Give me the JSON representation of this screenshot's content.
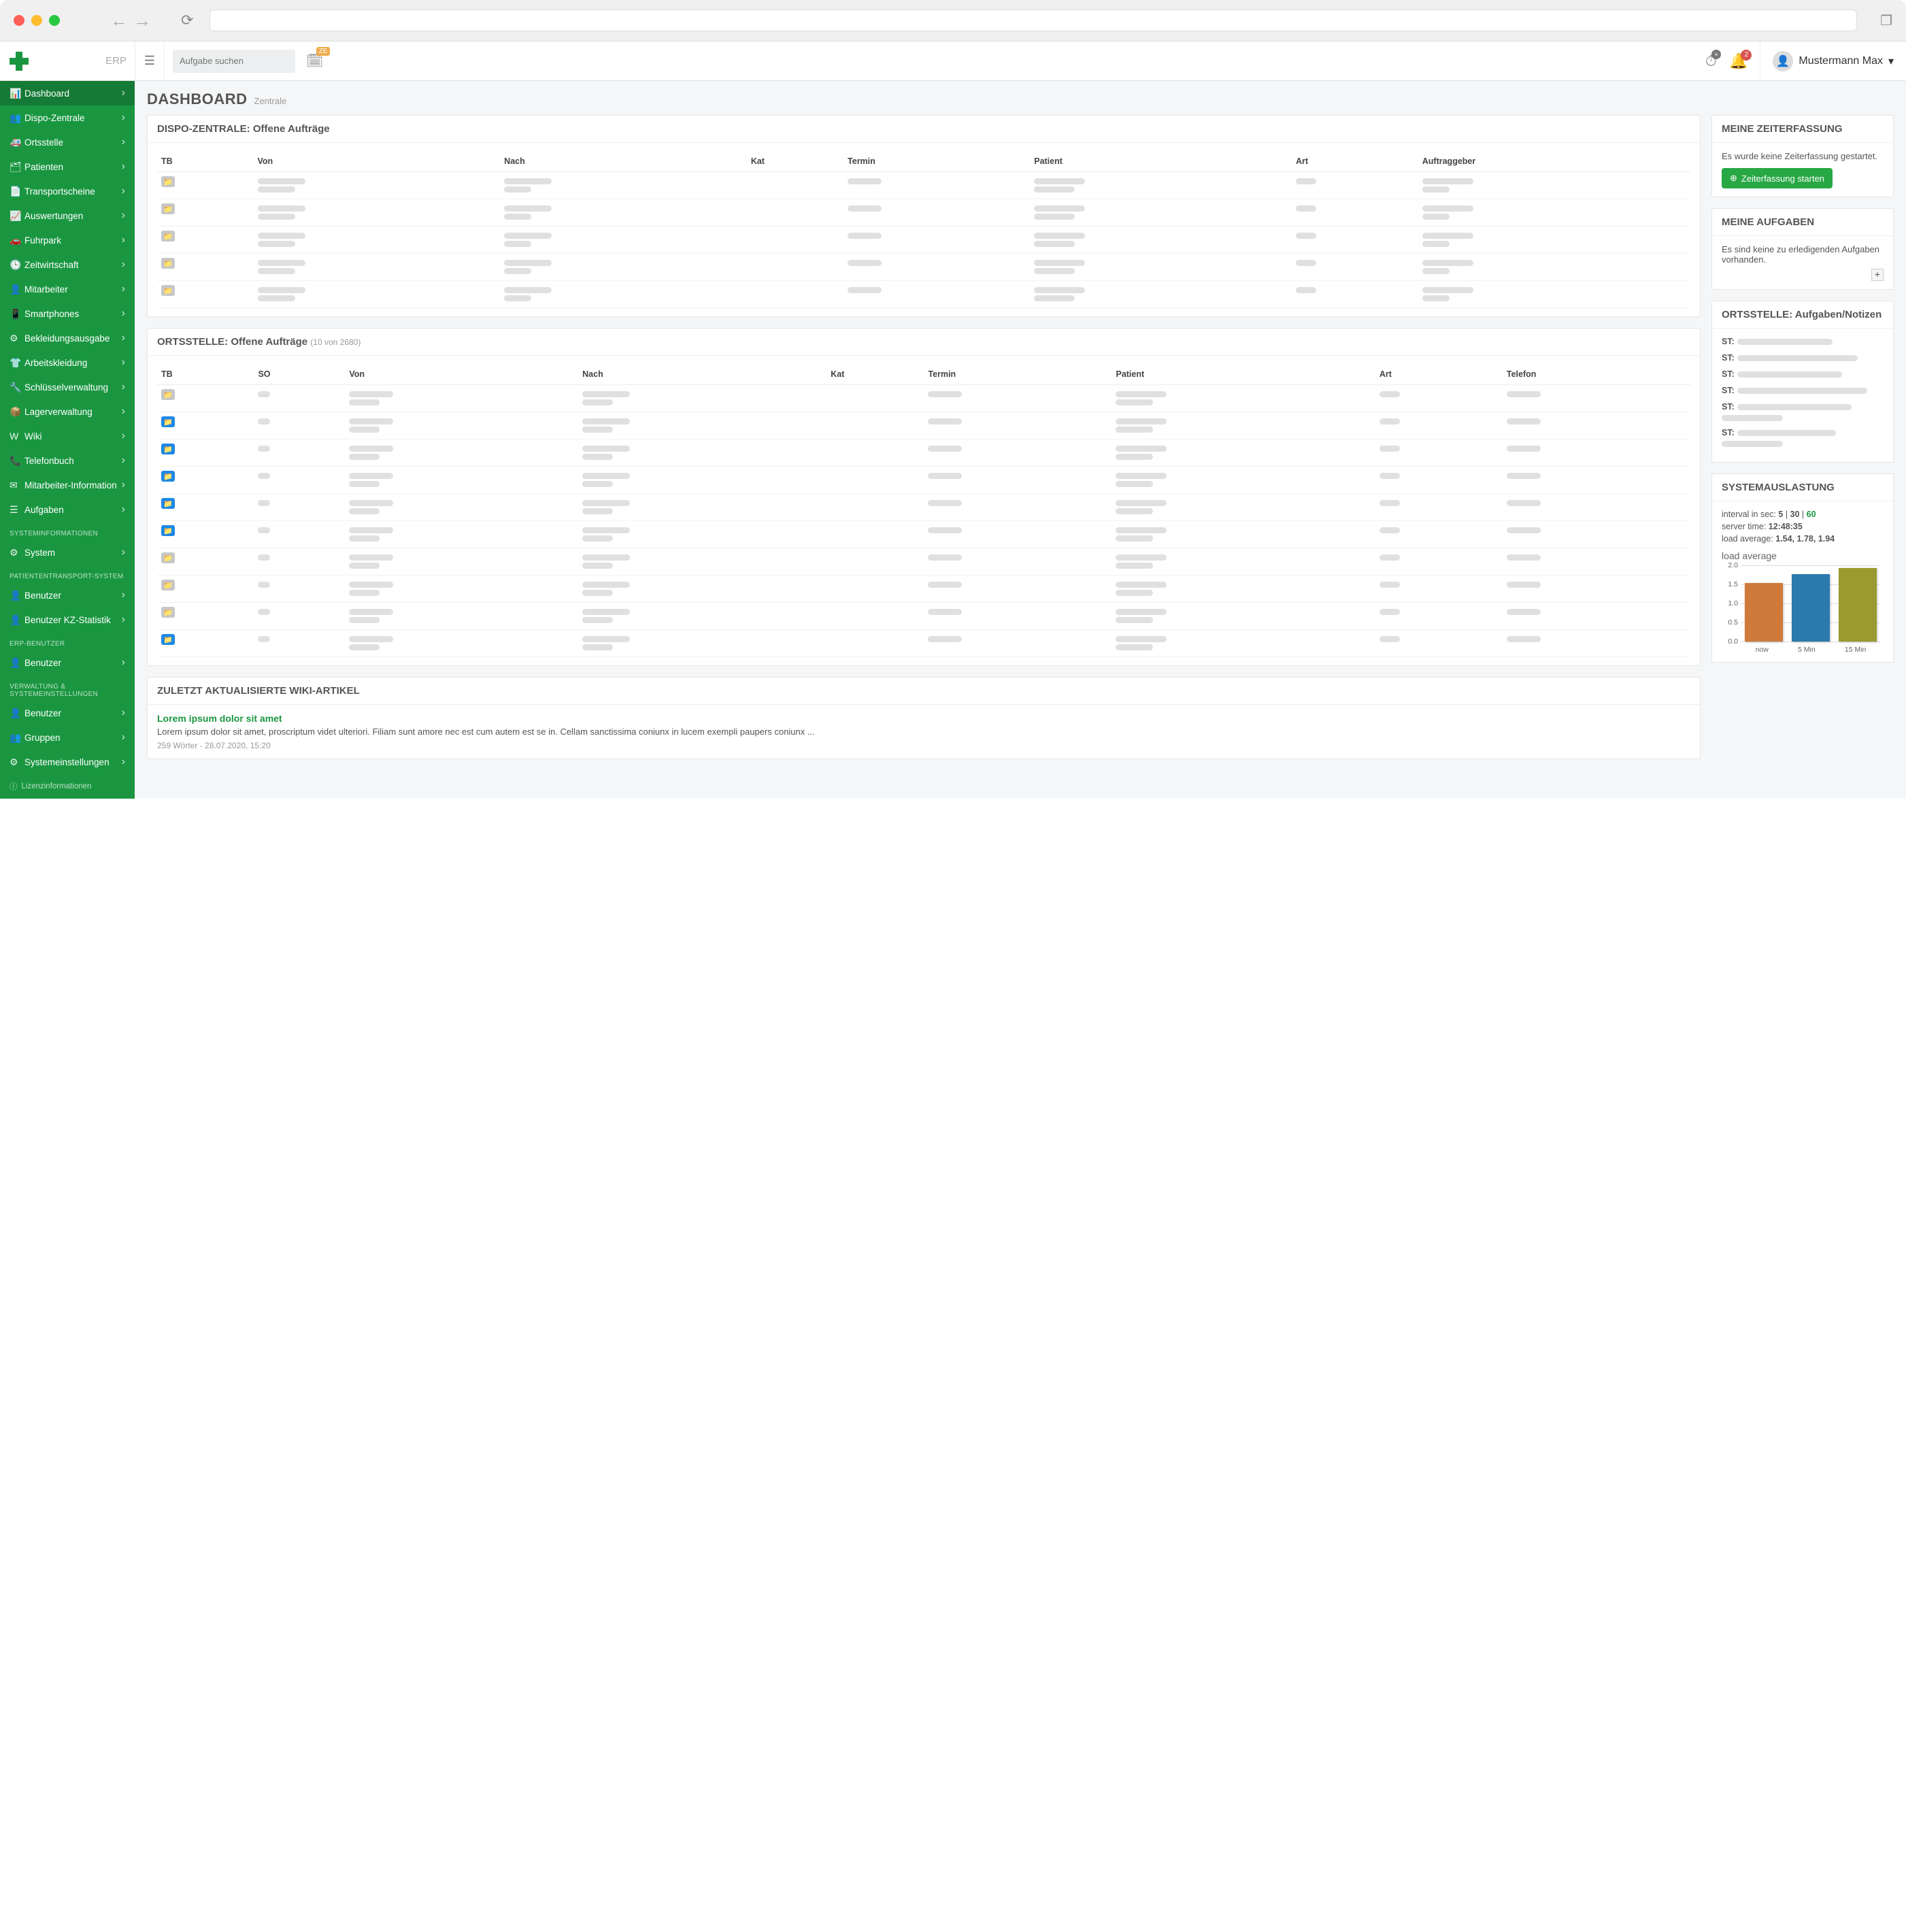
{
  "brand": {
    "text": "ERP"
  },
  "header": {
    "search_placeholder": "Aufgabe suchen",
    "ze_badge": "ZE",
    "notif_count": "2",
    "clock_badge": "×",
    "user_name": "Mustermann Max"
  },
  "sidebar": {
    "items": [
      {
        "icon": "📊",
        "label": "Dashboard",
        "active": true
      },
      {
        "icon": "👥",
        "label": "Dispo-Zentrale"
      },
      {
        "icon": "🚑",
        "label": "Ortsstelle"
      },
      {
        "icon": "🗂",
        "label": "Patienten"
      },
      {
        "icon": "📄",
        "label": "Transportscheine"
      },
      {
        "icon": "📈",
        "label": "Auswertungen"
      },
      {
        "icon": "🚗",
        "label": "Fuhrpark"
      },
      {
        "icon": "🕒",
        "label": "Zeitwirtschaft"
      },
      {
        "icon": "👤",
        "label": "Mitarbeiter"
      },
      {
        "icon": "📱",
        "label": "Smartphones"
      },
      {
        "icon": "⚙",
        "label": "Bekleidungsausgabe"
      },
      {
        "icon": "👕",
        "label": "Arbeitskleidung"
      },
      {
        "icon": "🔧",
        "label": "Schlüsselverwaltung"
      },
      {
        "icon": "📦",
        "label": "Lagerverwaltung"
      },
      {
        "icon": "W",
        "label": "Wiki"
      },
      {
        "icon": "📞",
        "label": "Telefonbuch"
      },
      {
        "icon": "✉",
        "label": "Mitarbeiter-Information"
      },
      {
        "icon": "☰",
        "label": "Aufgaben"
      }
    ],
    "sections": [
      {
        "title": "SYSTEMINFORMATIONEN",
        "items": [
          {
            "icon": "⚙",
            "label": "System"
          }
        ]
      },
      {
        "title": "PATIENTENTRANSPORT-SYSTEM",
        "items": [
          {
            "icon": "👤",
            "label": "Benutzer"
          },
          {
            "icon": "👤",
            "label": "Benutzer KZ-Statistik"
          }
        ]
      },
      {
        "title": "ERP-BENUTZER",
        "items": [
          {
            "icon": "👤",
            "label": "Benutzer"
          }
        ]
      },
      {
        "title": "VERWALTUNG & SYSTEMEINSTELLUNGEN",
        "items": [
          {
            "icon": "👤",
            "label": "Benutzer"
          },
          {
            "icon": "👥",
            "label": "Gruppen"
          },
          {
            "icon": "⚙",
            "label": "Systemeinstellungen"
          }
        ]
      }
    ],
    "footer": "Lizenzinformationen"
  },
  "page": {
    "title": "DASHBOARD",
    "subtitle": "Zentrale"
  },
  "panels": {
    "dispo": {
      "title": "DISPO-ZENTRALE: Offene Aufträge",
      "columns": [
        "TB",
        "Von",
        "Nach",
        "Kat",
        "Termin",
        "Patient",
        "Art",
        "Auftraggeber"
      ],
      "rows": 5
    },
    "ortsstelle": {
      "title": "ORTSSTELLE: Offene Aufträge",
      "title_suffix": "(10 von 2680)",
      "columns": [
        "TB",
        "SO",
        "Von",
        "Nach",
        "Kat",
        "Termin",
        "Patient",
        "Art",
        "Telefon"
      ],
      "row_styles": [
        "grey",
        "blue",
        "blue",
        "blue",
        "blue",
        "blue",
        "grey",
        "grey",
        "grey",
        "blue"
      ]
    },
    "wiki": {
      "title": "ZULETZT AKTUALISIERTE WIKI-ARTIKEL",
      "article_title": "Lorem ipsum dolor sit amet",
      "article_body": "Lorem ipsum dolor sit amet, proscriptum videt ulteriori. Filiam sunt amore nec est cum autem est se in. Cellam sanctissima coniunx in lucem exempli paupers coniunx ...",
      "article_meta": "259 Wörter - 28.07.2020, 15:20"
    },
    "zeiterfassung": {
      "title": "MEINE ZEITERFASSUNG",
      "text": "Es wurde keine Zeiterfassung gestartet.",
      "button": "Zeiterfassung starten"
    },
    "aufgaben": {
      "title": "MEINE AUFGABEN",
      "text": "Es sind keine zu erledigenden Aufgaben vorhanden."
    },
    "notizen": {
      "title": "ORTSSTELLE: Aufgaben/Notizen",
      "rows": 6,
      "prefix": "ST:"
    },
    "system": {
      "title": "SYSTEMAUSLASTUNG",
      "interval_label": "interval in sec:",
      "intervals": [
        "5",
        "30",
        "60"
      ],
      "server_time_label": "server time:",
      "server_time": "12:48:35",
      "load_label": "load average:",
      "load_text": "1.54, 1.78, 1.94"
    }
  },
  "chart_data": {
    "type": "bar",
    "title": "load average",
    "categories": [
      "now",
      "5 Min",
      "15 Min"
    ],
    "values": [
      1.54,
      1.78,
      1.94
    ],
    "ylim": [
      0,
      2.0
    ],
    "yticks": [
      0.0,
      0.5,
      1.0,
      1.5,
      2.0
    ],
    "colors": [
      "#cf7a3a",
      "#2a7aae",
      "#9a9a2e"
    ]
  }
}
